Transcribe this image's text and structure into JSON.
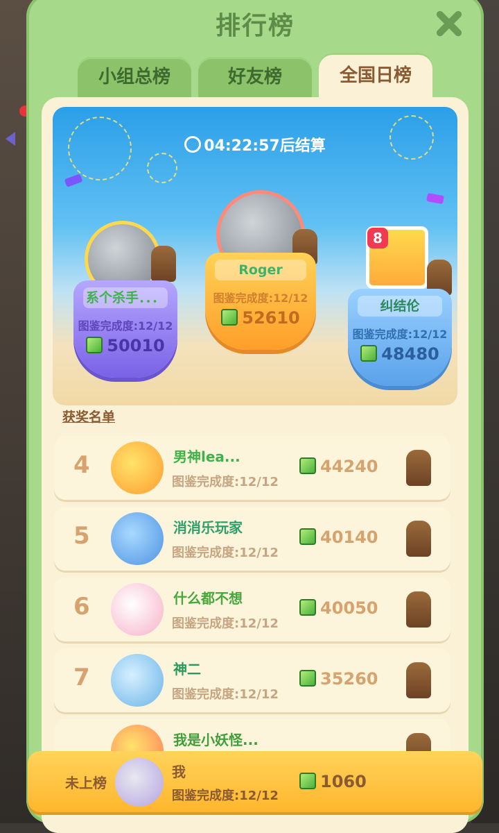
{
  "window": {
    "title": "排行榜"
  },
  "tabs": [
    {
      "label": "小组总榜",
      "active": false
    },
    {
      "label": "好友榜",
      "active": false
    },
    {
      "label": "全国日榜",
      "active": true
    }
  ],
  "timer": {
    "text": "04:22:57后结算"
  },
  "podium": {
    "first": {
      "name": "Roger",
      "progress": "图鉴完成度:12/12",
      "score": "52610"
    },
    "second": {
      "name": "系个杀手．．．",
      "progress": "图鉴完成度:12/12",
      "score": "50010"
    },
    "third": {
      "name": "纠结伦",
      "progress": "图鉴完成度:12/12",
      "score": "48480",
      "badge": "8"
    }
  },
  "section": {
    "title": "获奖名单"
  },
  "list": [
    {
      "rank": "4",
      "name": "男神lea...",
      "progress": "图鉴完成度:12/12",
      "score": "44240",
      "color": "#3fb24a"
    },
    {
      "rank": "5",
      "name": "消消乐玩家",
      "progress": "图鉴完成度:12/12",
      "score": "40140",
      "color": "#2f9f6a"
    },
    {
      "rank": "6",
      "name": "什么都不想",
      "progress": "图鉴完成度:12/12",
      "score": "40050",
      "color": "#46a83a"
    },
    {
      "rank": "7",
      "name": "神二",
      "progress": "图鉴完成度:12/12",
      "score": "35260",
      "color": "#2a9a5c"
    },
    {
      "rank": "",
      "name": "我是小妖怪...",
      "progress": "",
      "score": "",
      "color": "#3fa03a"
    }
  ],
  "me": {
    "status": "未上榜",
    "name": "我",
    "progress": "图鉴完成度:12/12",
    "score": "1060"
  },
  "icons": {
    "close": "close-icon",
    "score": "cube-icon",
    "timer": "clock-icon",
    "reward": "bear-icon"
  },
  "colors": {
    "panel": "#a7d98a",
    "active_tab": "#fbf1d6",
    "accent_gold": "#ffb62e"
  }
}
